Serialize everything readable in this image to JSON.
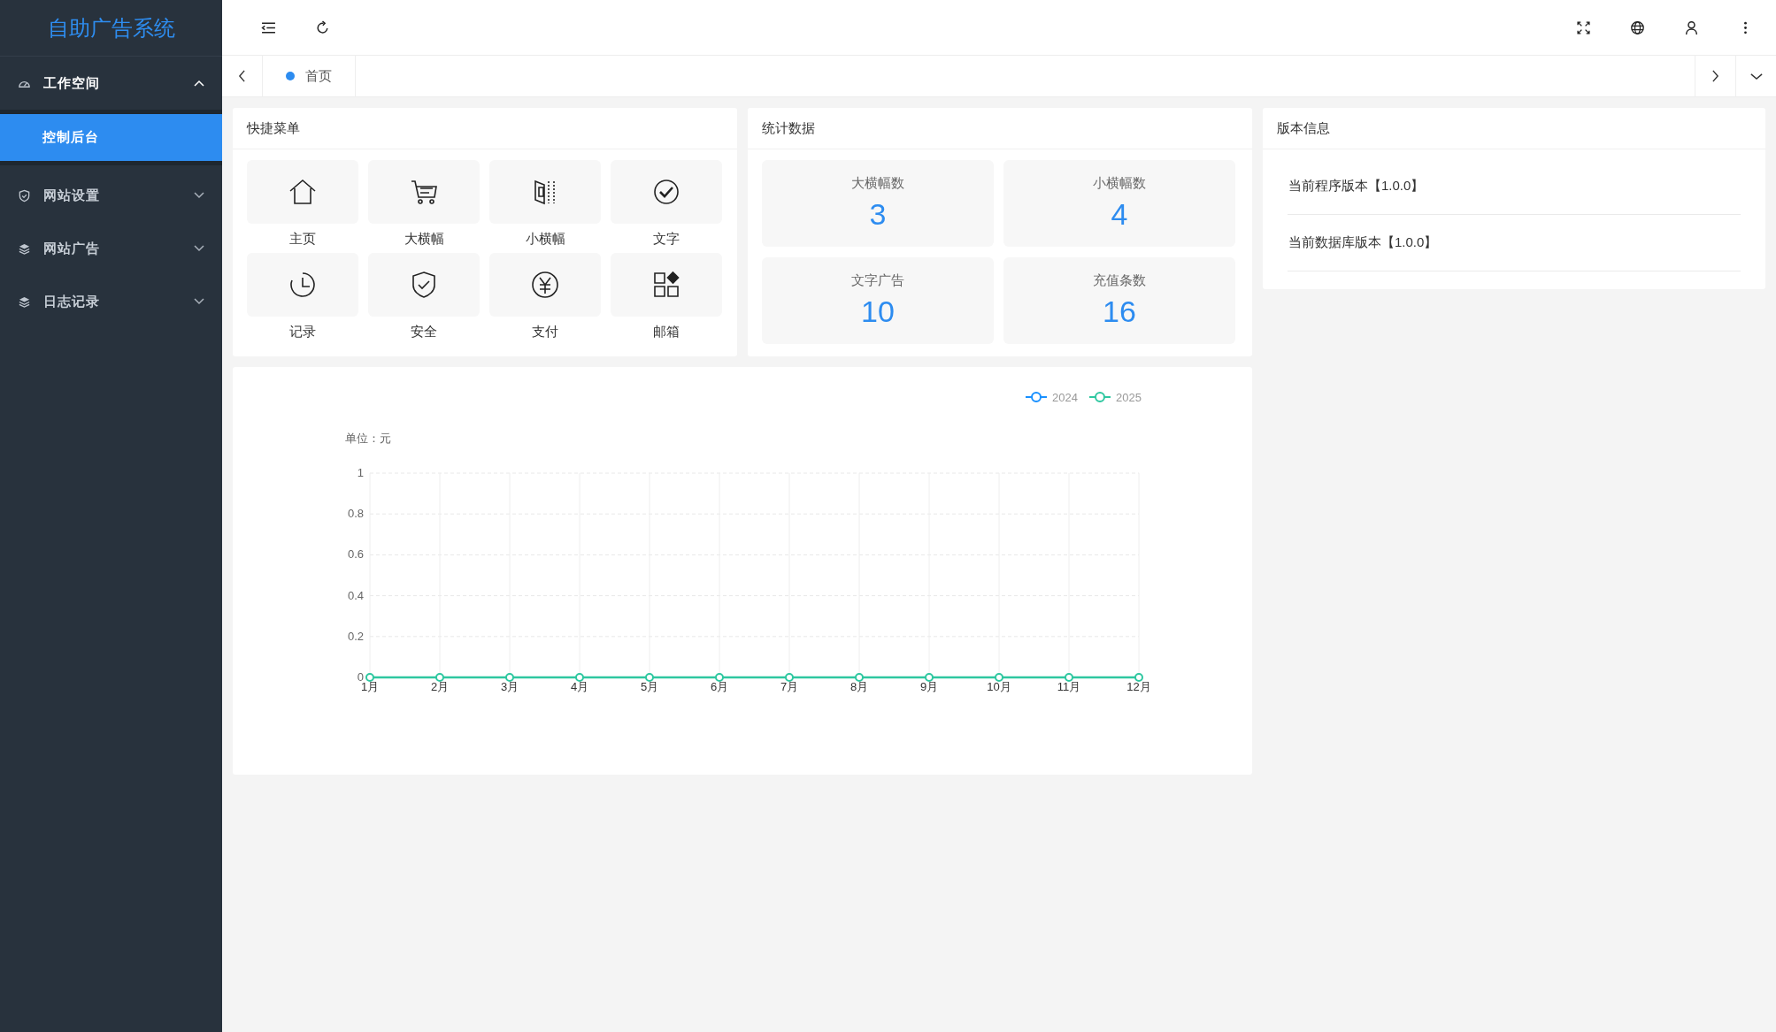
{
  "sidebar": {
    "logo": "自助广告系统",
    "items": [
      {
        "label": "工作空间",
        "expanded": true,
        "children": [
          {
            "label": "控制后台",
            "selected": true
          }
        ]
      },
      {
        "label": "网站设置",
        "expanded": false
      },
      {
        "label": "网站广告",
        "expanded": false
      },
      {
        "label": "日志记录",
        "expanded": false
      }
    ]
  },
  "tabs": [
    {
      "label": "首页",
      "selected": true
    }
  ],
  "quick_menu": {
    "title": "快捷菜单",
    "items": [
      {
        "label": "主页"
      },
      {
        "label": "大横幅"
      },
      {
        "label": "小横幅"
      },
      {
        "label": "文字"
      },
      {
        "label": "记录"
      },
      {
        "label": "安全"
      },
      {
        "label": "支付"
      },
      {
        "label": "邮箱"
      }
    ]
  },
  "stats": {
    "title": "统计数据",
    "items": [
      {
        "label": "大横幅数",
        "value": "3"
      },
      {
        "label": "小横幅数",
        "value": "4"
      },
      {
        "label": "文字广告",
        "value": "10"
      },
      {
        "label": "充值条数",
        "value": "16"
      }
    ]
  },
  "version": {
    "title": "版本信息",
    "items": [
      "当前程序版本【1.0.0】",
      "当前数据库版本【1.0.0】"
    ]
  },
  "chart": {
    "chart_data": {
      "type": "line",
      "ylabel": "单位：元",
      "categories": [
        "1月",
        "2月",
        "3月",
        "4月",
        "5月",
        "6月",
        "7月",
        "8月",
        "9月",
        "10月",
        "11月",
        "12月"
      ],
      "series": [
        {
          "name": "2024",
          "color": "#1890ff",
          "marker": "circle",
          "values": [
            null,
            null,
            null,
            null,
            null,
            null,
            null,
            null,
            null,
            null,
            null,
            null
          ]
        },
        {
          "name": "2025",
          "color": "#2ec7a0",
          "marker": "circle",
          "values": [
            0,
            0,
            0,
            0,
            0,
            0,
            0,
            0,
            0,
            0,
            0,
            0
          ]
        }
      ],
      "grid": true,
      "legend": true,
      "ylim": [
        0,
        1
      ],
      "yticks": [
        0,
        0.2,
        0.4,
        0.6,
        0.8,
        1
      ]
    }
  }
}
